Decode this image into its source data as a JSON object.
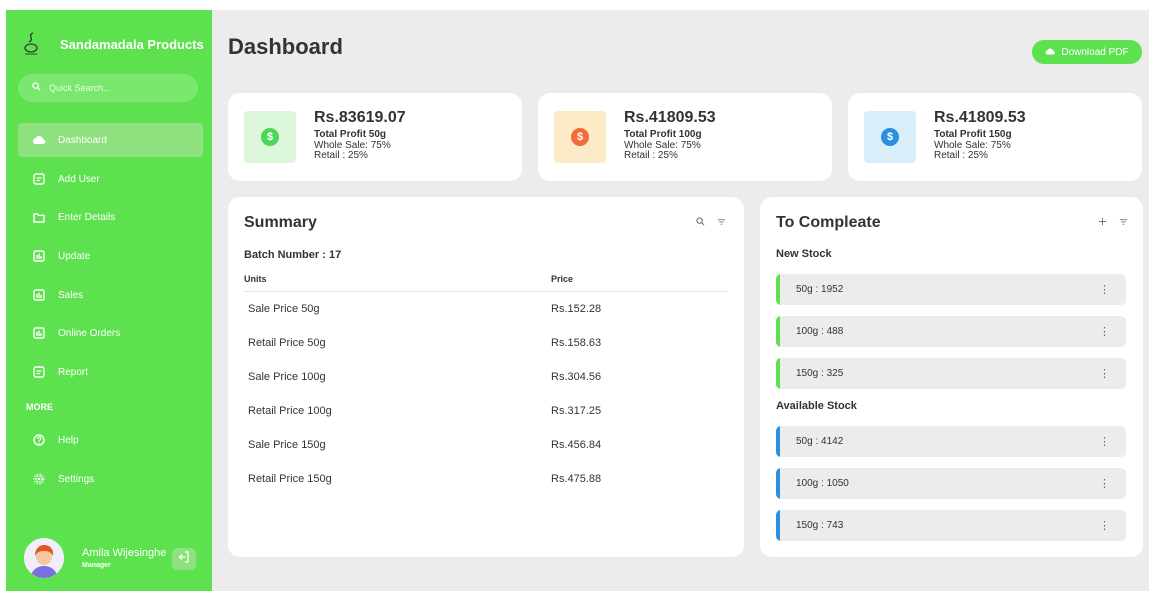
{
  "brand": {
    "name": "Sandamadala Products"
  },
  "search": {
    "placeholder": "Quick Search..."
  },
  "nav": {
    "items": [
      {
        "label": "Dashboard",
        "icon": "cloud-icon"
      },
      {
        "label": "Add User",
        "icon": "form-icon"
      },
      {
        "label": "Enter Details",
        "icon": "folder-icon"
      },
      {
        "label": "Update",
        "icon": "chart-icon"
      },
      {
        "label": "Sales",
        "icon": "chart-icon"
      },
      {
        "label": "Online Orders",
        "icon": "chart-icon"
      },
      {
        "label": "Report",
        "icon": "form-icon"
      }
    ],
    "more_label": "MORE",
    "more_items": [
      {
        "label": "Help",
        "icon": "help-icon"
      },
      {
        "label": "Settings",
        "icon": "gear-icon"
      }
    ]
  },
  "user": {
    "name": "Amila Wijesinghe",
    "role": "Manager"
  },
  "header": {
    "title": "Dashboard",
    "download_label": "Download PDF"
  },
  "cards": [
    {
      "amount": "Rs.83619.07",
      "label": "Total Profit 50g",
      "line2": "Whole Sale: 75%",
      "line3": "Retail : 25%",
      "bg": "#dcf7d9",
      "coin": "#4fd65a"
    },
    {
      "amount": "Rs.41809.53",
      "label": "Total Profit 100g",
      "line2": "Whole Sale: 75%",
      "line3": "Retail : 25%",
      "bg": "#fdebc8",
      "coin": "#f26b3a"
    },
    {
      "amount": "Rs.41809.53",
      "label": "Total Profit 150g",
      "line2": "Whole Sale: 75%",
      "line3": "Retail : 25%",
      "bg": "#d8eefb",
      "coin": "#2a8fdc"
    }
  ],
  "summary": {
    "title": "Summary",
    "batch": "Batch Number : 17",
    "columns": [
      "Units",
      "Price"
    ],
    "rows": [
      [
        "Sale Price 50g",
        "Rs.152.28"
      ],
      [
        "Retail Price 50g",
        "Rs.158.63"
      ],
      [
        "Sale Price 100g",
        "Rs.304.56"
      ],
      [
        "Retail Price 100g",
        "Rs.317.25"
      ],
      [
        "Sale Price 150g",
        "Rs.456.84"
      ],
      [
        "Retail Price 150g",
        "Rs.475.88"
      ]
    ]
  },
  "todo": {
    "title": "To Compleate",
    "new_label": "New Stock",
    "new_items": [
      "50g : 1952",
      "100g : 488",
      "150g : 325"
    ],
    "available_label": "Available Stock",
    "available_items": [
      "50g : 4142",
      "100g : 1050",
      "150g : 743"
    ]
  },
  "colors": {
    "accent": "#5de14f",
    "new_bar": "#5de14f",
    "available_bar": "#2a8fdc"
  }
}
